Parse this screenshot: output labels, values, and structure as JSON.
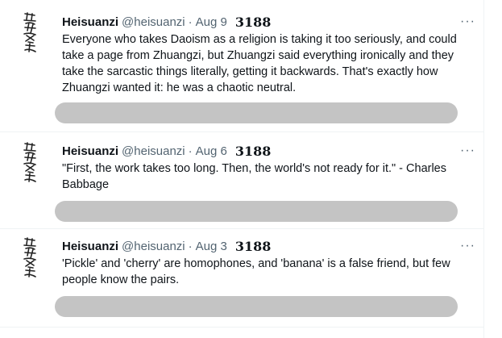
{
  "tweets": [
    {
      "author": "Heisuanzi",
      "handle": "@heisuanzi",
      "separator": "·",
      "date": "Aug 9",
      "number": "3188",
      "more": "···",
      "text": "Everyone who takes Daoism as a religion is taking it too seriously, and could take a page from Zhuangzi, but Zhuangzi said everything ironically and they take the sarcastic things literally, getting it backwards.  That's exactly how Zhuangzi wanted it: he was a chaotic neutral.",
      "avatar_icon": "calligraphy-avatar-icon",
      "action_bar_color": "#c4c4c4"
    },
    {
      "author": "Heisuanzi",
      "handle": "@heisuanzi",
      "separator": "·",
      "date": "Aug 6",
      "number": "3188",
      "more": "···",
      "text": "\"First, the work takes too long.  Then, the world's not ready for it.\" - Charles Babbage",
      "avatar_icon": "calligraphy-avatar-icon",
      "action_bar_color": "#c4c4c4"
    },
    {
      "author": "Heisuanzi",
      "handle": "@heisuanzi",
      "separator": "·",
      "date": "Aug 3",
      "number": "3188",
      "more": "···",
      "text": "'Pickle' and 'cherry' are homophones, and 'banana' is a false friend, but few people know the pairs.",
      "avatar_icon": "calligraphy-avatar-icon",
      "action_bar_color": "#c4c4c4"
    }
  ]
}
